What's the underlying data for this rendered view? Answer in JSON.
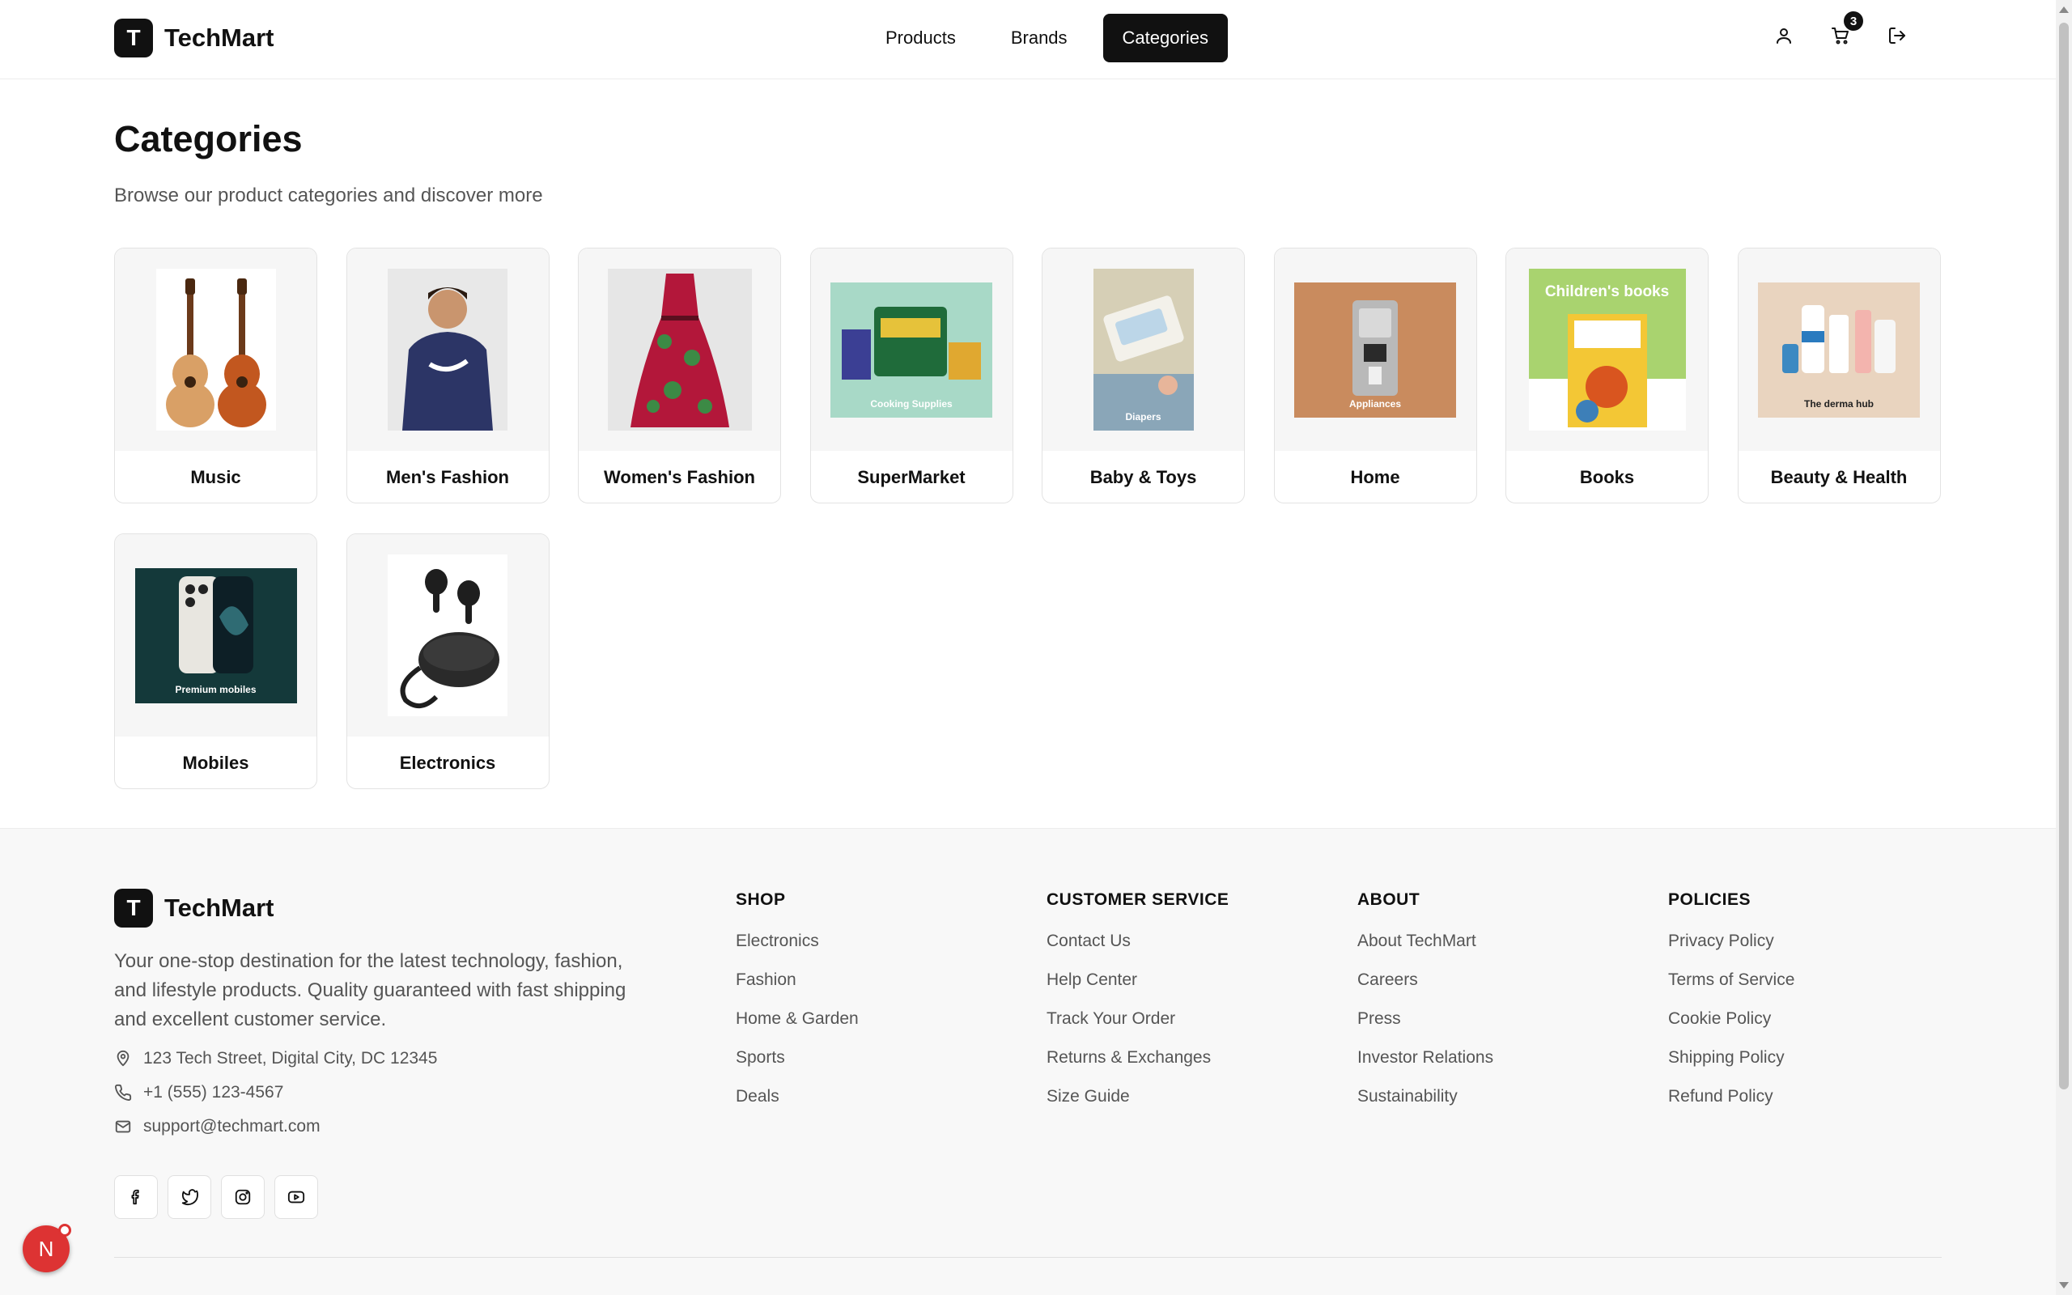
{
  "brand": {
    "logo_letter": "T",
    "name": "TechMart"
  },
  "nav": {
    "items": [
      {
        "label": "Products",
        "active": false
      },
      {
        "label": "Brands",
        "active": false
      },
      {
        "label": "Categories",
        "active": true
      }
    ]
  },
  "header_icons": {
    "user": "user-icon",
    "cart": "cart-icon",
    "cart_count": "3",
    "logout": "logout-icon"
  },
  "main": {
    "title": "Categories",
    "subtitle": "Browse our product categories and discover more",
    "categories": [
      {
        "label": "Music",
        "image": "guitars"
      },
      {
        "label": "Men's Fashion",
        "image": "hoodie-model"
      },
      {
        "label": "Women's Fashion",
        "image": "floral-dress"
      },
      {
        "label": "SuperMarket",
        "image": "cooking-supplies",
        "caption": "Cooking Supplies"
      },
      {
        "label": "Baby & Toys",
        "image": "diapers",
        "caption": "Diapers"
      },
      {
        "label": "Home",
        "image": "appliances",
        "caption": "Appliances"
      },
      {
        "label": "Books",
        "image": "childrens-books",
        "caption": "Children's books"
      },
      {
        "label": "Beauty & Health",
        "image": "derma-hub",
        "caption": "The derma hub"
      },
      {
        "label": "Mobiles",
        "image": "premium-mobiles",
        "caption": "Premium mobiles"
      },
      {
        "label": "Electronics",
        "image": "earbuds"
      }
    ]
  },
  "footer": {
    "brand_name": "TechMart",
    "description": "Your one-stop destination for the latest technology, fashion, and lifestyle products. Quality guaranteed with fast shipping and excellent customer service.",
    "address": "123 Tech Street, Digital City, DC 12345",
    "phone": "+1 (555) 123-4567",
    "email": "support@techmart.com",
    "socials": [
      "facebook-icon",
      "twitter-icon",
      "instagram-icon",
      "youtube-icon"
    ],
    "columns": [
      {
        "title": "SHOP",
        "links": [
          "Electronics",
          "Fashion",
          "Home & Garden",
          "Sports",
          "Deals"
        ]
      },
      {
        "title": "CUSTOMER SERVICE",
        "links": [
          "Contact Us",
          "Help Center",
          "Track Your Order",
          "Returns & Exchanges",
          "Size Guide"
        ]
      },
      {
        "title": "ABOUT",
        "links": [
          "About TechMart",
          "Careers",
          "Press",
          "Investor Relations",
          "Sustainability"
        ]
      },
      {
        "title": "POLICIES",
        "links": [
          "Privacy Policy",
          "Terms of Service",
          "Cookie Policy",
          "Shipping Policy",
          "Refund Policy"
        ]
      }
    ]
  },
  "floating_avatar": {
    "letter": "N"
  },
  "colors": {
    "primary": "#111111",
    "muted_text": "#555555",
    "card_bg": "#f6f6f6",
    "footer_bg": "#f8f8f8",
    "avatar_red": "#dd3333"
  }
}
